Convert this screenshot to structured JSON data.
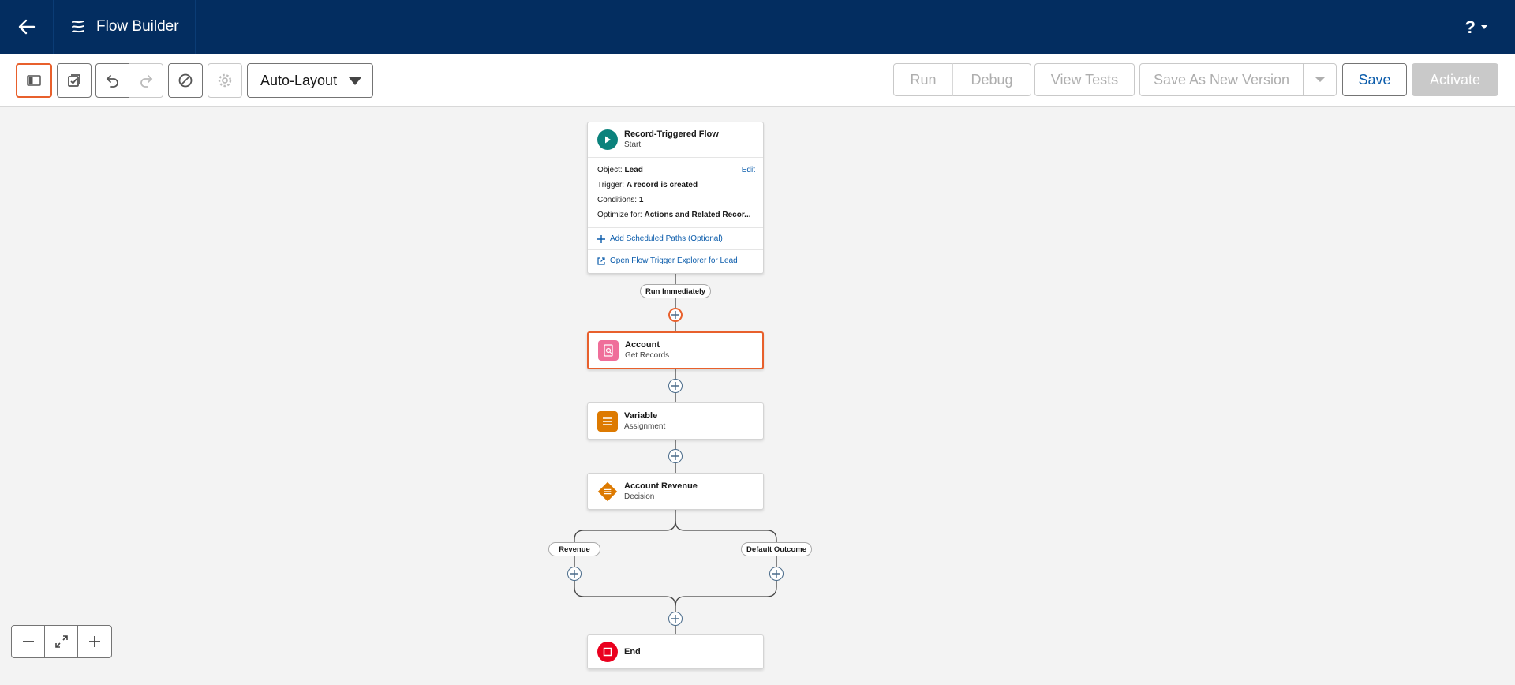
{
  "header": {
    "app_title": "Flow Builder",
    "help_label": "?"
  },
  "toolbar": {
    "layout_mode": "Auto-Layout",
    "run_label": "Run",
    "debug_label": "Debug",
    "view_tests_label": "View Tests",
    "save_as_new_label": "Save As New Version",
    "save_label": "Save",
    "activate_label": "Activate"
  },
  "start_node": {
    "title": "Record-Triggered Flow",
    "subtitle": "Start",
    "object_label": "Object:",
    "object_value": "Lead",
    "edit_label": "Edit",
    "trigger_label": "Trigger:",
    "trigger_value": "A record is created",
    "conditions_label": "Conditions:",
    "conditions_value": "1",
    "optimize_label": "Optimize for:",
    "optimize_value": "Actions and Related Recor...",
    "scheduled_paths_label": "Add Scheduled Paths (Optional)",
    "trigger_explorer_label": "Open Flow Trigger Explorer for Lead"
  },
  "run_immediately_label": "Run Immediately",
  "nodes": [
    {
      "title": "Account",
      "subtitle": "Get Records",
      "color": "#ef6e9a",
      "icon": "get-records-icon"
    },
    {
      "title": "Variable",
      "subtitle": "Assignment",
      "color": "#dd7a01",
      "icon": "assignment-icon"
    },
    {
      "title": "Account Revenue",
      "subtitle": "Decision",
      "color": "#dd7a01",
      "icon": "decision-icon"
    }
  ],
  "outcomes": [
    "Revenue",
    "Default Outcome"
  ],
  "end_node": {
    "title": "End",
    "color": "#ea001e",
    "icon": "end-icon"
  },
  "colors": {
    "header_bg": "#032d60",
    "selection": "#e8602c",
    "start_icon": "#0b827c",
    "link": "#0b5cab"
  }
}
